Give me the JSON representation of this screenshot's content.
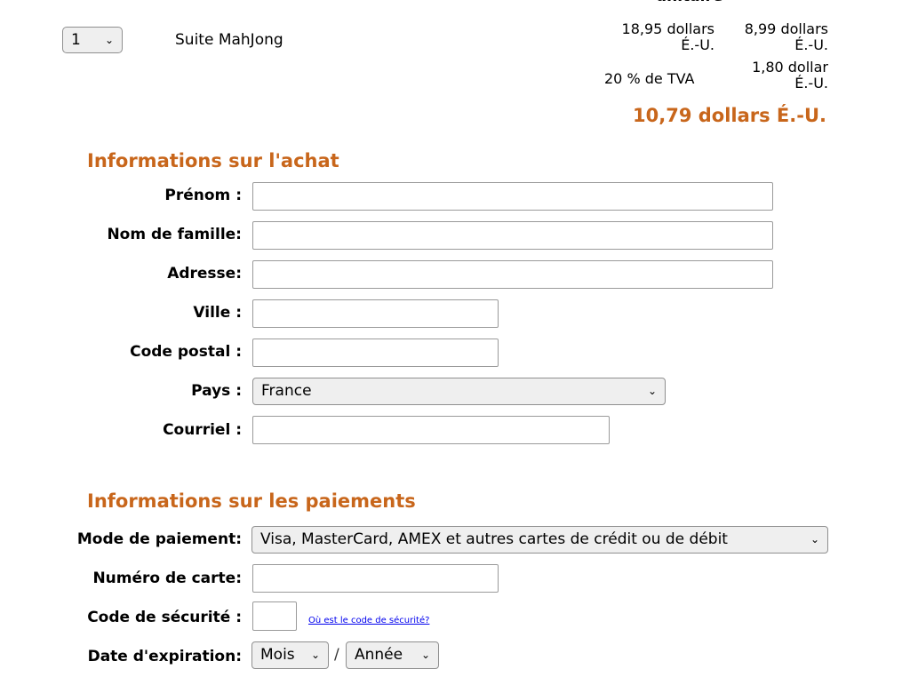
{
  "cart": {
    "partial_header": "unitaire",
    "quantity": "1",
    "product": "Suite MahJong",
    "orig_price_line1": "18,95 dollars",
    "orig_price_line2": "É.-U.",
    "unit_price_line1": "8,99 dollars",
    "unit_price_line2": "É.-U.",
    "vat_label": "20 % de TVA",
    "vat_amount_line1": "1,80 dollar",
    "vat_amount_line2": "É.-U.",
    "total": "10,79 dollars É.-U.",
    "accent_color": "#c8661b"
  },
  "purchase": {
    "heading": "Informations sur l'achat",
    "first_name_label": "Prénom :",
    "last_name_label": "Nom de famille:",
    "address_label": "Adresse:",
    "city_label": "Ville :",
    "postal_label": "Code postal :",
    "country_label": "Pays :",
    "country_value": "France",
    "email_label": "Courriel :"
  },
  "payment": {
    "heading": "Informations sur les paiements",
    "method_label": "Mode de paiement:",
    "method_value": "Visa, MasterCard, AMEX et autres cartes de crédit ou de débit",
    "card_number_label": "Numéro de carte:",
    "security_code_label": "Code de sécurité :",
    "security_code_link": "Où est le code de sécurité?",
    "expiry_label": "Date d'expiration:",
    "month_value": "Mois",
    "separator": "/",
    "year_value": "Année"
  }
}
